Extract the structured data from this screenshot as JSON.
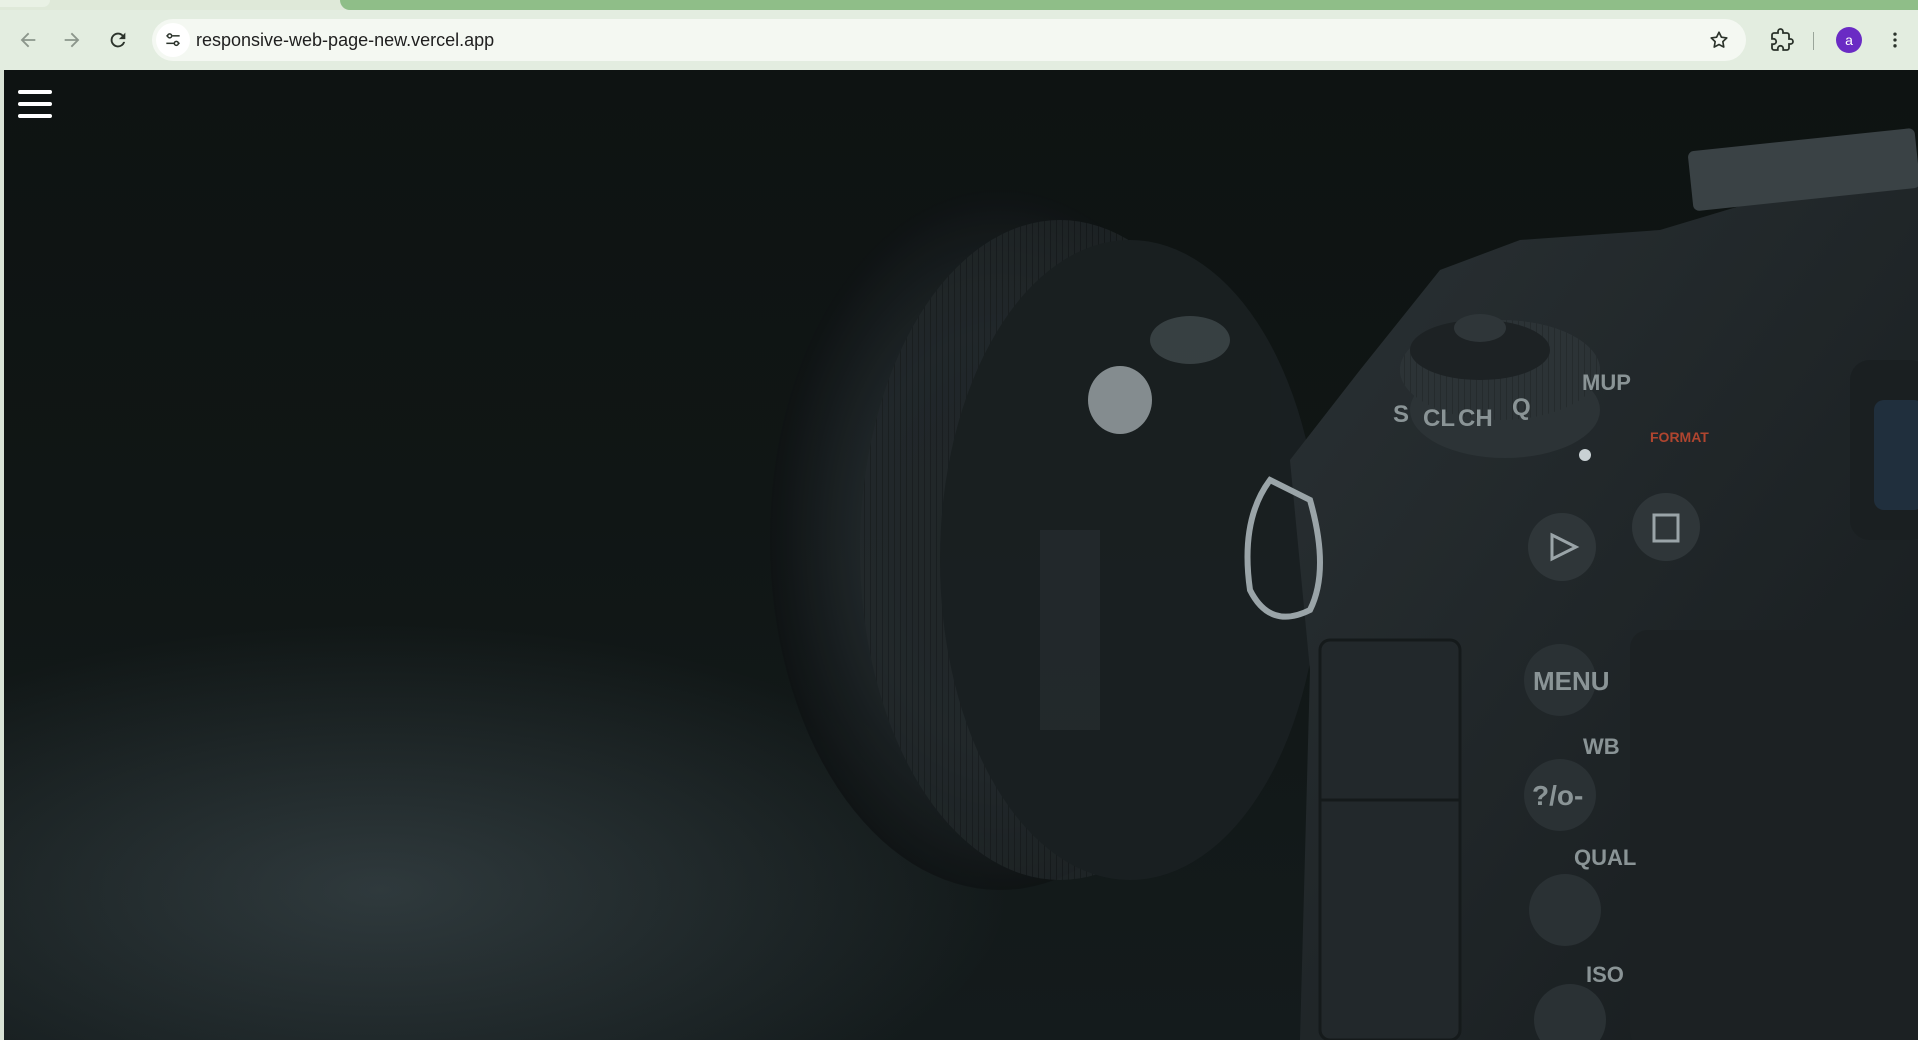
{
  "browser": {
    "url": "responsive-web-page-new.vercel.app",
    "profile_initial": "a",
    "colors": {
      "toolbar": "#e3ede0",
      "tab_highlight": "#8fbe88",
      "avatar": "#6a2bc4"
    },
    "icons": {
      "back": "arrow-left-icon",
      "forward": "arrow-right-icon",
      "reload": "reload-icon",
      "site_info": "tune-icon",
      "bookmark": "star-icon",
      "extensions": "puzzle-icon",
      "menu": "kebab-menu-icon"
    }
  },
  "page": {
    "nav_icon": "hamburger-menu-icon",
    "hero_image": "dslr-camera-photo",
    "camera_labels": {
      "menu": "MENU",
      "wb": "WB",
      "qual": "QUAL",
      "iso": "ISO",
      "format": "FORMAT",
      "mup": "MUP",
      "q": "Q",
      "ch": "CH",
      "cl": "CL",
      "s": "S",
      "protect": "?/o-"
    }
  }
}
